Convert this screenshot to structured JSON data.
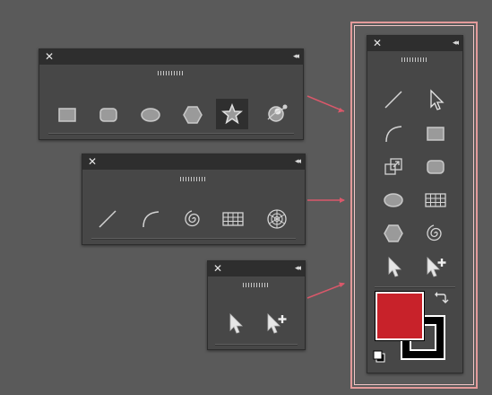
{
  "panels": {
    "shapes": {
      "close_glyph": "✕",
      "collapse_glyph": "◂◂",
      "tools": [
        "rectangle-tool-icon",
        "rounded-rectangle-tool-icon",
        "ellipse-tool-icon",
        "polygon-tool-icon",
        "star-tool-icon",
        "flare-tool-icon"
      ],
      "selected_tool": "star-tool-icon"
    },
    "lines": {
      "close_glyph": "✕",
      "collapse_glyph": "◂◂",
      "tools": [
        "line-segment-tool-icon",
        "arc-tool-icon",
        "spiral-tool-icon",
        "rectangular-grid-tool-icon",
        "polar-grid-tool-icon"
      ]
    },
    "selection": {
      "close_glyph": "✕",
      "collapse_glyph": "◂◂",
      "tools": [
        "selection-tool-icon",
        "add-selection-tool-icon"
      ]
    },
    "combined": {
      "close_glyph": "✕",
      "collapse_glyph": "◂◂",
      "tools": [
        "line-segment-tool-icon",
        "direct-selection-tool-icon",
        "arc-tool-icon",
        "rectangle-tool-icon",
        "scale-tool-icon",
        "rounded-rectangle-tool-icon",
        "ellipse-tool-icon",
        "rectangular-grid-tool-icon",
        "polygon-tool-icon",
        "spiral-tool-icon",
        "selection-tool-icon",
        "add-selection-tool-icon"
      ],
      "fill_color": "#c8222a",
      "stroke_color": "#000000",
      "swap_icon": "swap-fill-stroke-icon",
      "default_icon": "default-fill-stroke-icon"
    }
  },
  "colors": {
    "background": "#5a5a5a",
    "panel": "#474747",
    "titlebar": "#2e2e2e",
    "arrow": "#d9586a",
    "highlight": "#e39a9a"
  }
}
